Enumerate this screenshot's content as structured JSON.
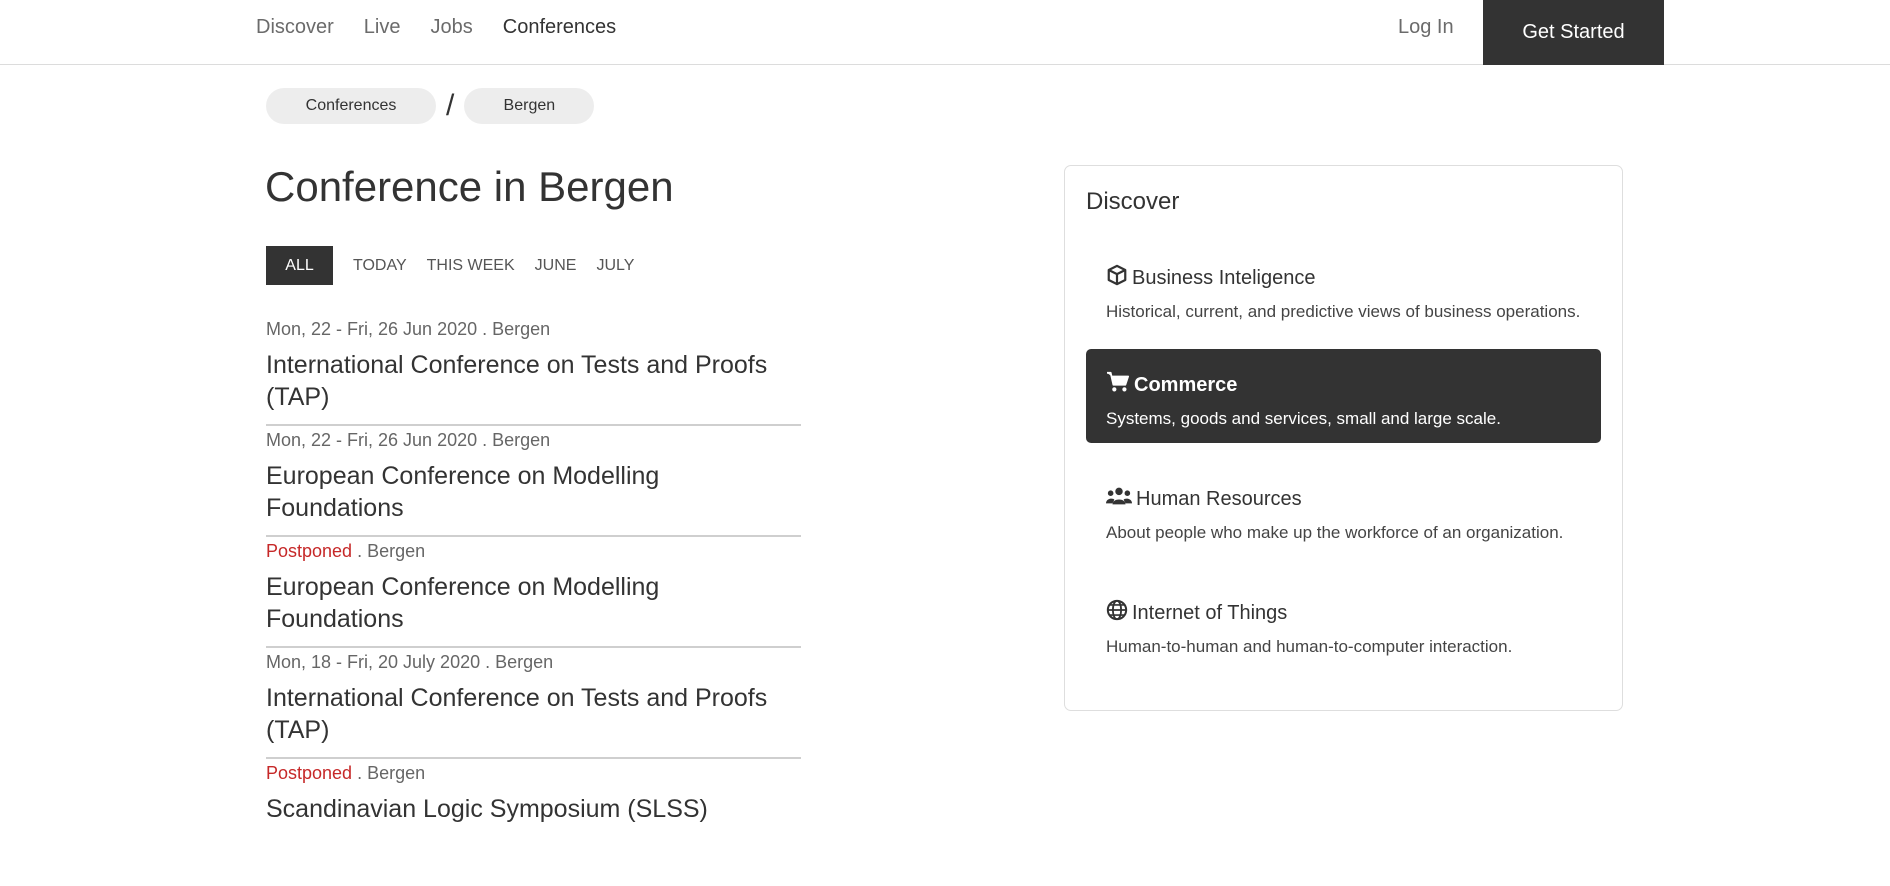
{
  "nav": {
    "links": [
      "Discover",
      "Live",
      "Jobs",
      "Conferences"
    ],
    "login": "Log In",
    "get_started": "Get Started"
  },
  "breadcrumb": [
    "Conferences",
    "Bergen"
  ],
  "page_title": "Conference in Bergen",
  "tabs": [
    "ALL",
    "TODAY",
    "THIS WEEK",
    "JUNE",
    "JULY"
  ],
  "events": [
    {
      "date": "Mon, 22 - Fri, 26 Jun 2020",
      "status": "",
      "location": " . Bergen",
      "title": "International Conference on Tests and Proofs (TAP)"
    },
    {
      "date": "Mon, 22 - Fri, 26 Jun 2020",
      "status": "",
      "location": " . Bergen",
      "title": "European Conference on Modelling Foundations"
    },
    {
      "date": "",
      "status": "Postponed",
      "location": " . Bergen",
      "title": "European Conference on Modelling Foundations"
    },
    {
      "date": "Mon, 18 - Fri, 20 July 2020",
      "status": "",
      "location": " . Bergen",
      "title": "International Conference on Tests and Proofs (TAP)"
    },
    {
      "date": "",
      "status": "Postponed",
      "location": " . Bergen",
      "title": "Scandinavian Logic Symposium (SLSS)"
    }
  ],
  "discover": {
    "title": "Discover",
    "categories": [
      {
        "icon": "cube-icon",
        "name": "Business Inteligence",
        "desc": "Historical, current, and predictive views of business operations."
      },
      {
        "icon": "shopping-cart-icon",
        "name": "Commerce",
        "desc": "Systems, goods and services, small and large scale."
      },
      {
        "icon": "users-icon",
        "name": "Human Resources",
        "desc": "About people who make up the workforce of an organization."
      },
      {
        "icon": "globe-icon",
        "name": "Internet of Things",
        "desc": "Human-to-human and human-to-computer interaction."
      }
    ]
  },
  "colors": {
    "accent": "#333333",
    "postponed": "#c62828"
  }
}
